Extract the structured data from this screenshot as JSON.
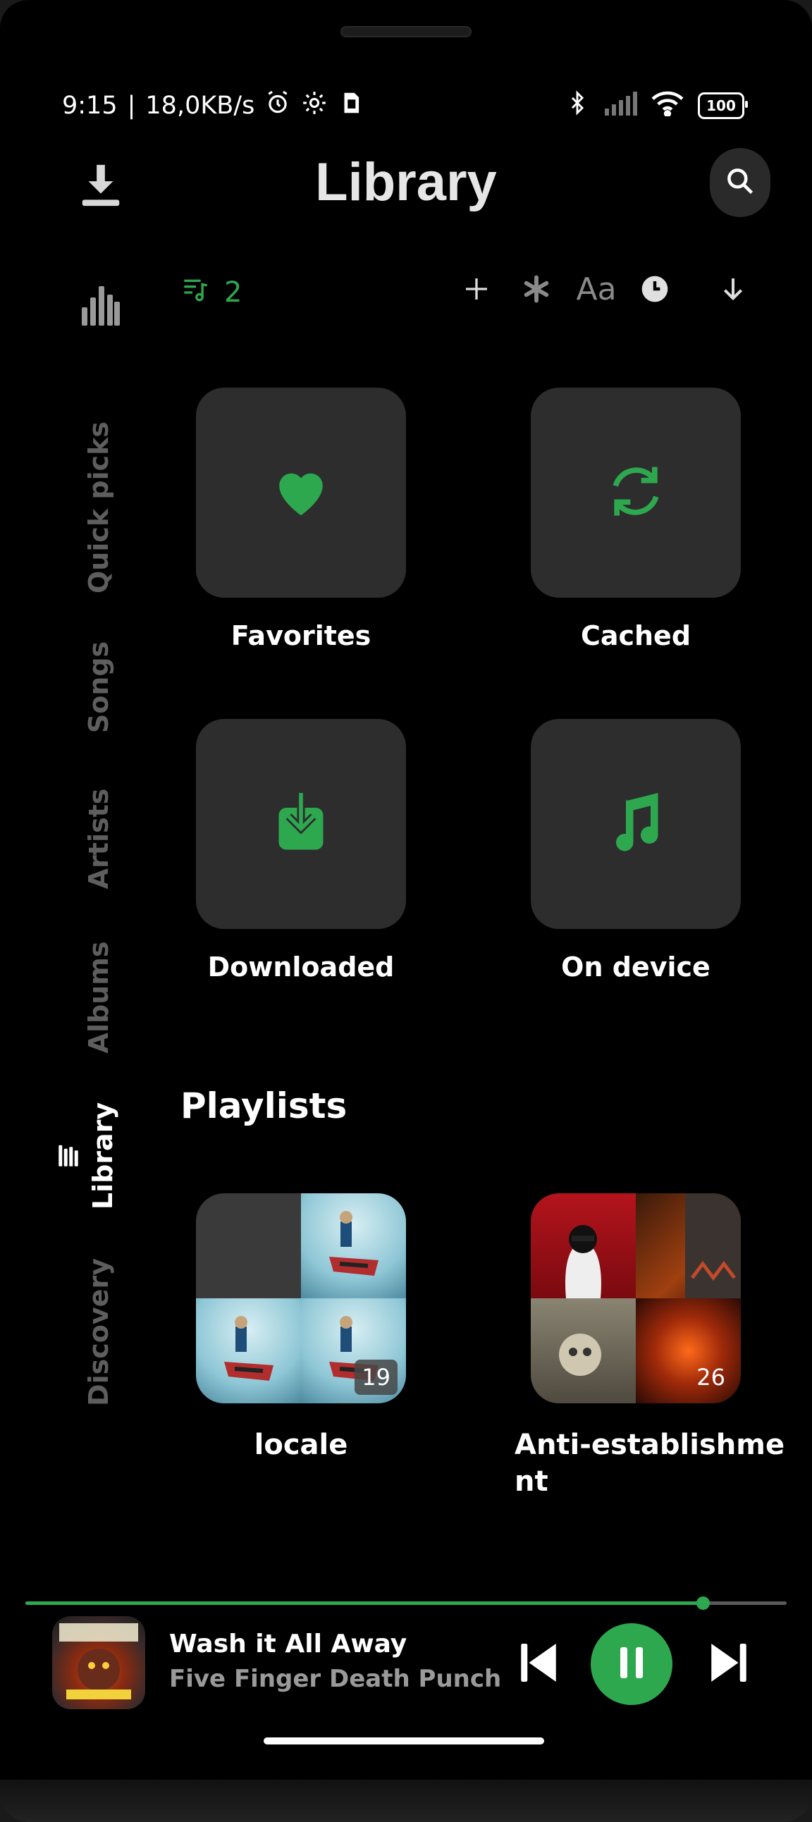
{
  "status_bar": {
    "time": "9:15",
    "separator": "|",
    "speed": "18,0KB/s",
    "battery": "100"
  },
  "header": {
    "title": "Library"
  },
  "toolbar": {
    "queue_count": "2",
    "text_size_label": "Aa"
  },
  "nav": {
    "items": [
      {
        "label": "Quick picks",
        "active": false
      },
      {
        "label": "Songs",
        "active": false
      },
      {
        "label": "Artists",
        "active": false
      },
      {
        "label": "Albums",
        "active": false
      },
      {
        "label": "Library",
        "active": true
      },
      {
        "label": "Discovery",
        "active": false
      }
    ]
  },
  "tiles": [
    {
      "label": "Favorites",
      "icon": "heart-icon"
    },
    {
      "label": "Cached",
      "icon": "sync-icon"
    },
    {
      "label": "Downloaded",
      "icon": "download-box-icon"
    },
    {
      "label": "On device",
      "icon": "music-note-icon"
    }
  ],
  "playlists_section": {
    "title": "Playlists",
    "items": [
      {
        "name": "locale",
        "count": "19"
      },
      {
        "name_line1": "Anti-establishme",
        "name_line2": "nt",
        "count": "26"
      }
    ]
  },
  "player": {
    "song": "Wash it All Away",
    "artist": "Five Finger Death Punch",
    "progress": 0.89
  },
  "colors": {
    "accent": "#2ea84f",
    "tile_bg": "#2d2d2d",
    "background": "#000000"
  }
}
